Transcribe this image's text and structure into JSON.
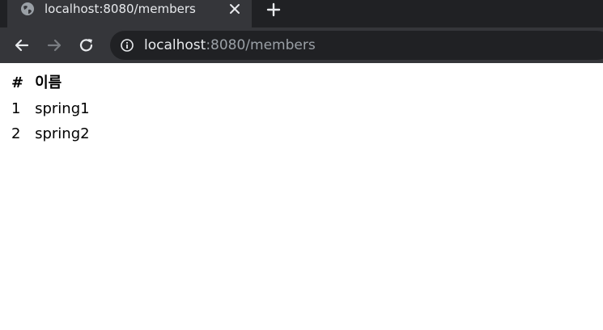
{
  "tab": {
    "title": "localhost:8080/members",
    "favicon": "globe-icon",
    "close": "close-icon"
  },
  "newtab": {
    "icon": "plus-icon"
  },
  "toolbar": {
    "back": "arrow-left-icon",
    "forward": "arrow-right-icon",
    "reload": "reload-icon",
    "info": "info-icon"
  },
  "address": {
    "host": "localhost",
    "rest": ":8080/members"
  },
  "table": {
    "headers": [
      "#",
      "이름"
    ],
    "rows": [
      {
        "id": "1",
        "name": "spring1"
      },
      {
        "id": "2",
        "name": "spring2"
      }
    ]
  },
  "colors": {
    "tabstrip": "#202124",
    "active_tab": "#35363a",
    "toolbar": "#35363a",
    "omnibox": "#202124",
    "text_light": "#e8eaed",
    "text_dim": "#9aa0a6"
  }
}
